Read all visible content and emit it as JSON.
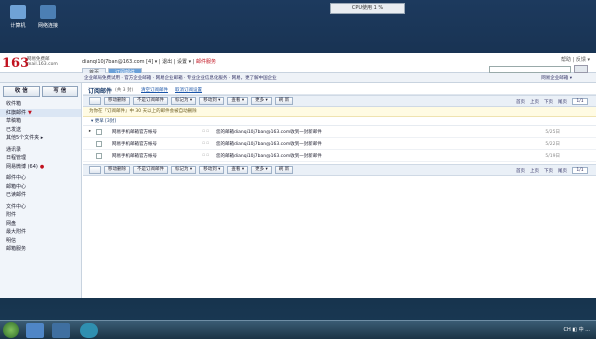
{
  "desktop": {
    "icons": [
      {
        "label": "计算机",
        "color": "#6fa2d6"
      },
      {
        "label": "网络连接",
        "color": "#4c7fb4"
      }
    ],
    "cpu_label": "CPU使用 1 %"
  },
  "header": {
    "logo": "163",
    "logo_sub1": "网易免费邮",
    "logo_sub2": "mail.163.com",
    "user": "dianqi10j7ban@163.com",
    "user_extra": "[4] ▾ | 退出 | 设置 ▾ |",
    "vip": "邮件服务",
    "top_links": "帮助 | 反馈 ▾",
    "tabs": [
      "首页",
      "订阅邮件"
    ]
  },
  "subbar": {
    "crumb": "企业邮局免费试用 · 官方企业邮箱 · 网易企业邮箱 · 专业企业信息化服务 · 网易，更了解中国企业",
    "right": "网易企业邮箱 ▾"
  },
  "sidebar": {
    "receive_label": "收 信",
    "write_label": "写 信",
    "items": [
      {
        "label": "收件箱",
        "flag": ""
      },
      {
        "label": "红旗邮件",
        "flag": "▼"
      },
      {
        "label": "草稿箱",
        "flag": ""
      },
      {
        "label": "已发送",
        "flag": ""
      },
      {
        "label": "其他5个文件夹 ▸",
        "flag": ""
      },
      {
        "label": "通讯录",
        "flag": ""
      },
      {
        "label": "日程管理",
        "flag": ""
      },
      {
        "label": "网易微博 (64)",
        "flag": "●"
      },
      {
        "label": "邮件中心",
        "flag": ""
      },
      {
        "label": "邮箱中心",
        "flag": ""
      },
      {
        "label": "已读邮件",
        "flag": ""
      },
      {
        "label": "文件中心",
        "flag": ""
      },
      {
        "label": "附件",
        "flag": ""
      },
      {
        "label": "网盘",
        "flag": ""
      },
      {
        "label": "最大附件",
        "flag": ""
      },
      {
        "label": "明信",
        "flag": ""
      },
      {
        "label": "邮箱服务",
        "flag": ""
      }
    ]
  },
  "content": {
    "title": "订阅邮件",
    "count": "(共 3 封)",
    "link1": "清空订阅邮件",
    "link2": "取消订阅设置",
    "toolbar": [
      "移动删除",
      "不是订阅邮件",
      "标记为 ▾",
      "移动到 ▾",
      "查看 ▾",
      "更多 ▾",
      "刷 新"
    ],
    "pager": {
      "first": "首页",
      "prev": "上页",
      "next": "下页",
      "last": "尾页",
      "page": "1/1"
    },
    "notice": "为你在『订阅邮件』中 30 天以上的邮件会被自动删除",
    "group": "▾ 更早 [3封]",
    "rows": [
      {
        "sender": "网易手机邮箱官方帐号",
        "subject": "您的邮箱dianqi10j7ban@163.com收到一封新邮件",
        "date": "5/25日"
      },
      {
        "sender": "网易手机邮箱官方帐号",
        "subject": "您的邮箱dianqi10j7ban@163.com收到一封新邮件",
        "date": "5/22日"
      },
      {
        "sender": "网易手机邮箱官方帐号",
        "subject": "您的邮箱dianqi10j7ban@163.com收到一封新邮件",
        "date": "5/19日"
      }
    ]
  },
  "taskbar": {
    "tray": "CH ◧ 中 ..."
  }
}
